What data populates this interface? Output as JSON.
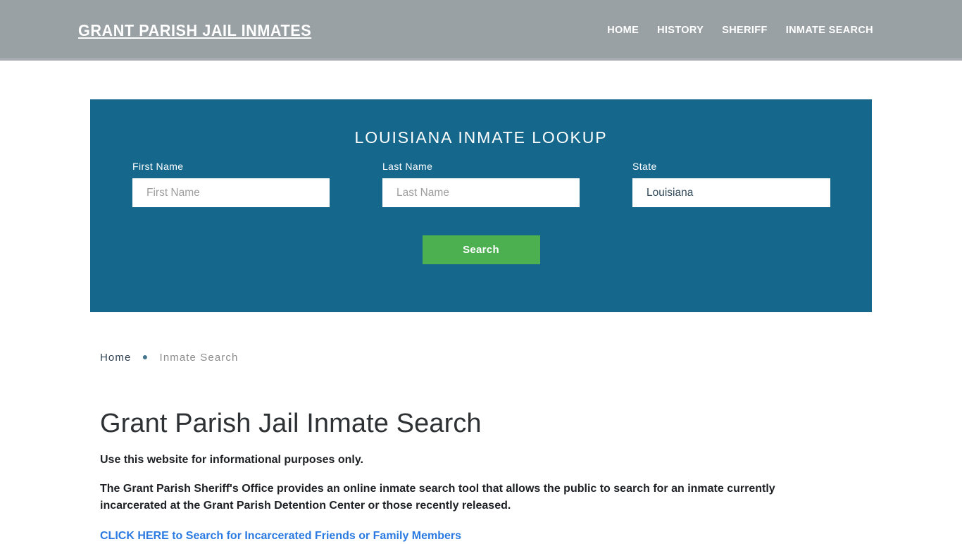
{
  "header": {
    "brand": "Grant Parish Jail Inmates",
    "background_color": "#9aa1a4",
    "nav": [
      {
        "label": "Home",
        "active": false
      },
      {
        "label": "History",
        "active": false
      },
      {
        "label": "Sheriff",
        "active": false
      },
      {
        "label": "Inmate Search",
        "active": true
      }
    ]
  },
  "lookup": {
    "title": "Louisiana Inmate Lookup",
    "panel_color": "#16678c",
    "fields": {
      "first_name": {
        "label": "First Name",
        "placeholder": "First Name",
        "value": ""
      },
      "last_name": {
        "label": "Last Name",
        "placeholder": "Last Name",
        "value": ""
      },
      "state": {
        "label": "State",
        "placeholder": "State",
        "value": "Louisiana"
      }
    },
    "search_button": {
      "label": "Search",
      "color": "#4cb050"
    }
  },
  "breadcrumb": {
    "home": "Home",
    "separator": "●",
    "current": "Inmate Search"
  },
  "content": {
    "title": "Grant Parish Jail Inmate Search",
    "lede": "Use this website for informational purposes only.",
    "paragraph": "The Grant Parish Sheriff's Office provides an online inmate search tool that allows the public to search for an inmate currently incarcerated at the Grant Parish Detention Center or those recently released.",
    "cta_link": "CLICK HERE to Search for Incarcerated Friends or Family Members",
    "link_color": "#2a7ae2"
  }
}
